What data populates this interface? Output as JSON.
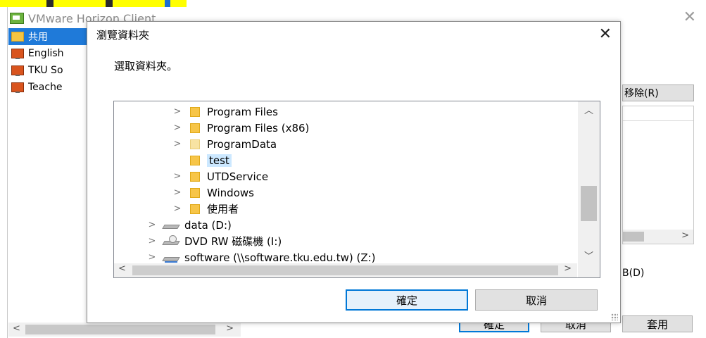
{
  "background_window": {
    "title": "VMware Horizon Client",
    "sidebar_items": [
      {
        "label": "共用",
        "icon": "folder-icon",
        "selected": true
      },
      {
        "label": "English",
        "icon": "desktop-icon"
      },
      {
        "label": "TKU So",
        "icon": "desktop-icon"
      },
      {
        "label": "Teache",
        "icon": "desktop-icon"
      }
    ],
    "remove_button": "移除(R)",
    "option_label": "B(D)",
    "buttons": {
      "ok": "確定",
      "cancel": "取消",
      "apply": "套用"
    }
  },
  "dialog": {
    "title": "瀏覽資料夾",
    "close_glyph": "✕",
    "instruction": "選取資料夾。",
    "tree": [
      {
        "label": "Program Files",
        "icon": "folder-icon",
        "expandable": true,
        "level": 2
      },
      {
        "label": "Program Files (x86)",
        "icon": "folder-icon",
        "expandable": true,
        "level": 2
      },
      {
        "label": "ProgramData",
        "icon": "folder-light-icon",
        "expandable": true,
        "level": 2
      },
      {
        "label": "test",
        "icon": "folder-icon",
        "expandable": false,
        "level": 2,
        "selected": true
      },
      {
        "label": "UTDService",
        "icon": "folder-icon",
        "expandable": true,
        "level": 2
      },
      {
        "label": "Windows",
        "icon": "folder-icon",
        "expandable": true,
        "level": 2
      },
      {
        "label": "使用者",
        "icon": "folder-icon",
        "expandable": true,
        "level": 2
      },
      {
        "label": "data (D:)",
        "icon": "drive-icon",
        "expandable": true,
        "level": 1
      },
      {
        "label": "DVD RW 磁碟機 (I:)",
        "icon": "dvd-drive-icon",
        "expandable": true,
        "level": 1
      },
      {
        "label": "software (\\\\software.tku.edu.tw) (Z:)",
        "icon": "network-drive-icon",
        "expandable": true,
        "level": 1
      }
    ],
    "ok_label": "確定",
    "cancel_label": "取消"
  },
  "colors": {
    "selection": "#cce8ff",
    "accent": "#0078d7",
    "highlight": "#ffff00"
  }
}
